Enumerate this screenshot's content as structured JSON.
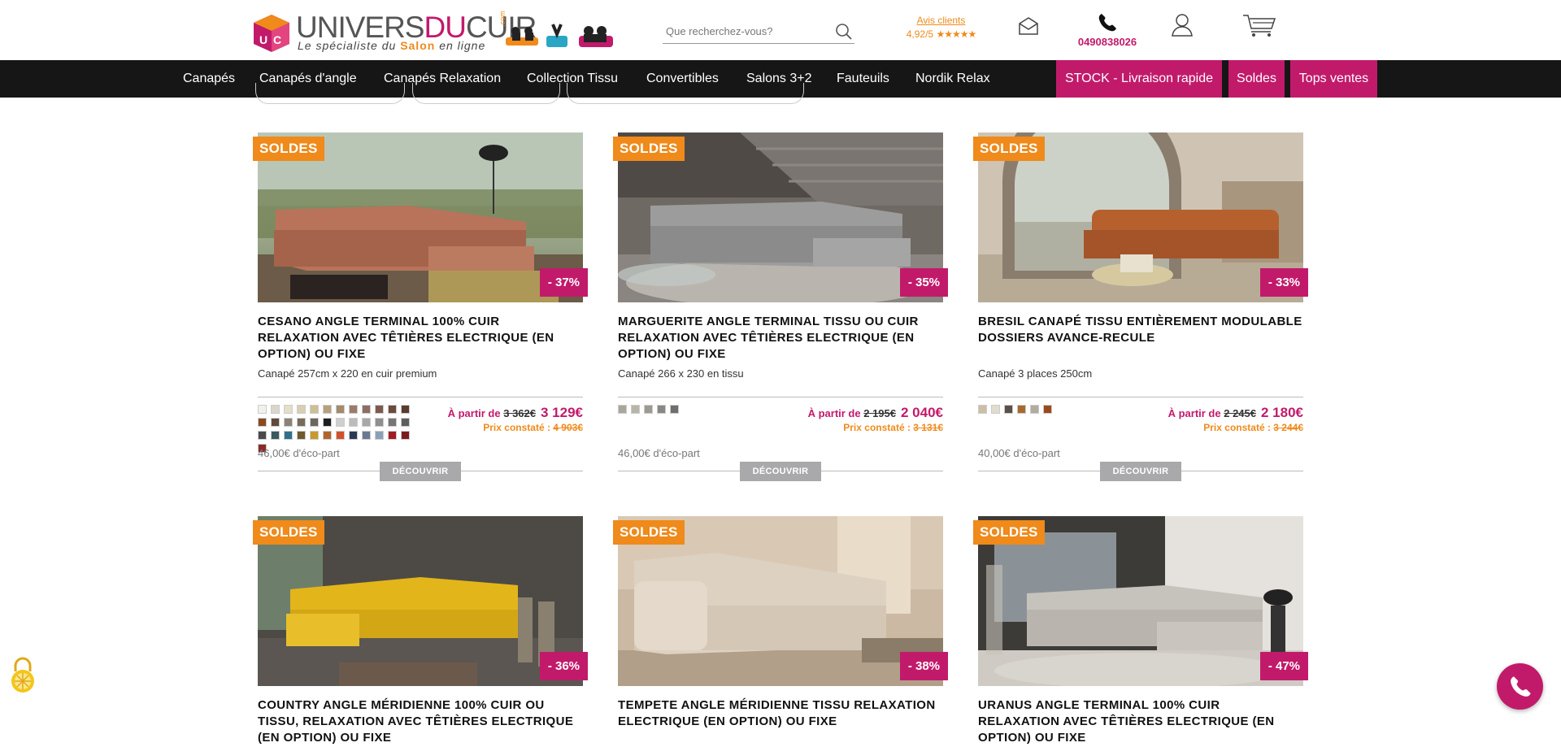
{
  "header": {
    "logo_word_a": "UNIVERS",
    "logo_word_b": "DU",
    "logo_word_c": "CUIR",
    "logo_com": ".com",
    "logo_tagline_a": "Le spécialiste du ",
    "logo_tagline_b": "Salon",
    "logo_tagline_c": " en ligne",
    "search_placeholder": "Que recherchez-vous?",
    "reviews_title": "Avis clients",
    "reviews_score": "4,92/5",
    "reviews_stars": "★★★★★",
    "phone_number": "0490838026"
  },
  "nav": {
    "items": [
      "Canapés",
      "Canapés d'angle",
      "Canapés Relaxation",
      "Collection Tissu",
      "Convertibles",
      "Salons 3+2",
      "Fauteuils",
      "Nordik Relax"
    ],
    "promos": [
      "STOCK - Livraison rapide",
      "Soldes",
      "Tops ventes"
    ]
  },
  "colors": {
    "brand_pink": "#c21a6b",
    "brand_orange": "#ef8a1b",
    "nav_bg": "#161616",
    "button_grey": "#a9a9ab"
  },
  "products": [
    {
      "badge": "SOLDES",
      "discount": "- 37%",
      "title": "CESANO ANGLE TERMINAL 100% CUIR RELAXATION AVEC TÊTIÈRES ELECTRIQUE (EN OPTION) OU FIXE",
      "subtitle": "Canapé 257cm x 220 en cuir premium",
      "price_from_label": "À partir de",
      "price_old": "3 362€",
      "price_new": "3 129€",
      "price_ref_label": "Prix constaté :",
      "price_ref": "4 903€",
      "ecopart": "46,00€ d'éco-part",
      "cta": "DÉCOUVRIR",
      "swatches": [
        "#f2f0ea",
        "#d9d6cc",
        "#e5dfc9",
        "#d7cfb3",
        "#cdbf95",
        "#b7a07a",
        "#a58a6b",
        "#9c7a6a",
        "#8d6e62",
        "#7c5b4e",
        "#6c4a3c",
        "#5a3b2e",
        "#8a4a22",
        "#5f4a3c",
        "#8b8378",
        "#7a6a5c",
        "#6b6660",
        "#1e1e1e",
        "#cfcfcf",
        "#bcbcbc",
        "#a8a8a8",
        "#8f8f8f",
        "#767676",
        "#5e5e5e",
        "#4a4a4a",
        "#3a5a5e",
        "#2f6f8a",
        "#6e5a2c",
        "#c79a2b",
        "#b2632b",
        "#d2512b",
        "#2a3a55",
        "#6a7a90",
        "#8aa0b8",
        "#a11c24",
        "#7d1a1e",
        "#8b2a2a"
      ],
      "scene": "rust"
    },
    {
      "badge": "SOLDES",
      "discount": "- 35%",
      "title": "MARGUERITE ANGLE TERMINAL TISSU OU CUIR RELAXATION AVEC TÊTIÈRES ELECTRIQUE (EN OPTION) OU FIXE",
      "subtitle": "Canapé 266 x 230 en tissu",
      "price_from_label": "À partir de",
      "price_old": "2 195€",
      "price_new": "2 040€",
      "price_ref_label": "Prix constaté :",
      "price_ref": "3 131€",
      "ecopart": "46,00€ d'éco-part",
      "cta": "DÉCOUVRIR",
      "swatches": [
        "#a9a69e",
        "#b8b4aa",
        "#9d9a93",
        "#8a8884",
        "#6f6e6c"
      ],
      "scene": "grey"
    },
    {
      "badge": "SOLDES",
      "discount": "- 33%",
      "title": "BRESIL CANAPÉ TISSU ENTIÈREMENT MODULABLE DOSSIERS AVANCE-RECULE",
      "subtitle": "Canapé 3 places 250cm",
      "price_from_label": "À partir de",
      "price_old": "2 245€",
      "price_new": "2 180€",
      "price_ref_label": "Prix constaté :",
      "price_ref": "3 244€",
      "ecopart": "40,00€ d'éco-part",
      "cta": "DÉCOUVRIR",
      "swatches": [
        "#cbbfa8",
        "#e2dccf",
        "#5a5048",
        "#a86a2c",
        "#b3aaa0",
        "#9a4a22"
      ],
      "scene": "orange"
    },
    {
      "badge": "SOLDES",
      "discount": "- 36%",
      "title": "COUNTRY ANGLE MÉRIDIENNE 100% CUIR OU TISSU, RELAXATION AVEC TÊTIÈRES ELECTRIQUE (EN OPTION) OU FIXE",
      "scene": "yellow"
    },
    {
      "badge": "SOLDES",
      "discount": "- 38%",
      "title": "TEMPETE ANGLE MÉRIDIENNE TISSU RELAXATION ELECTRIQUE (EN OPTION) OU FIXE",
      "scene": "beige"
    },
    {
      "badge": "SOLDES",
      "discount": "- 47%",
      "title": "URANUS ANGLE TERMINAL 100% CUIR RELAXATION AVEC TÊTIÈRES ELECTRIQUE (EN OPTION) OU FIXE",
      "scene": "light"
    }
  ]
}
